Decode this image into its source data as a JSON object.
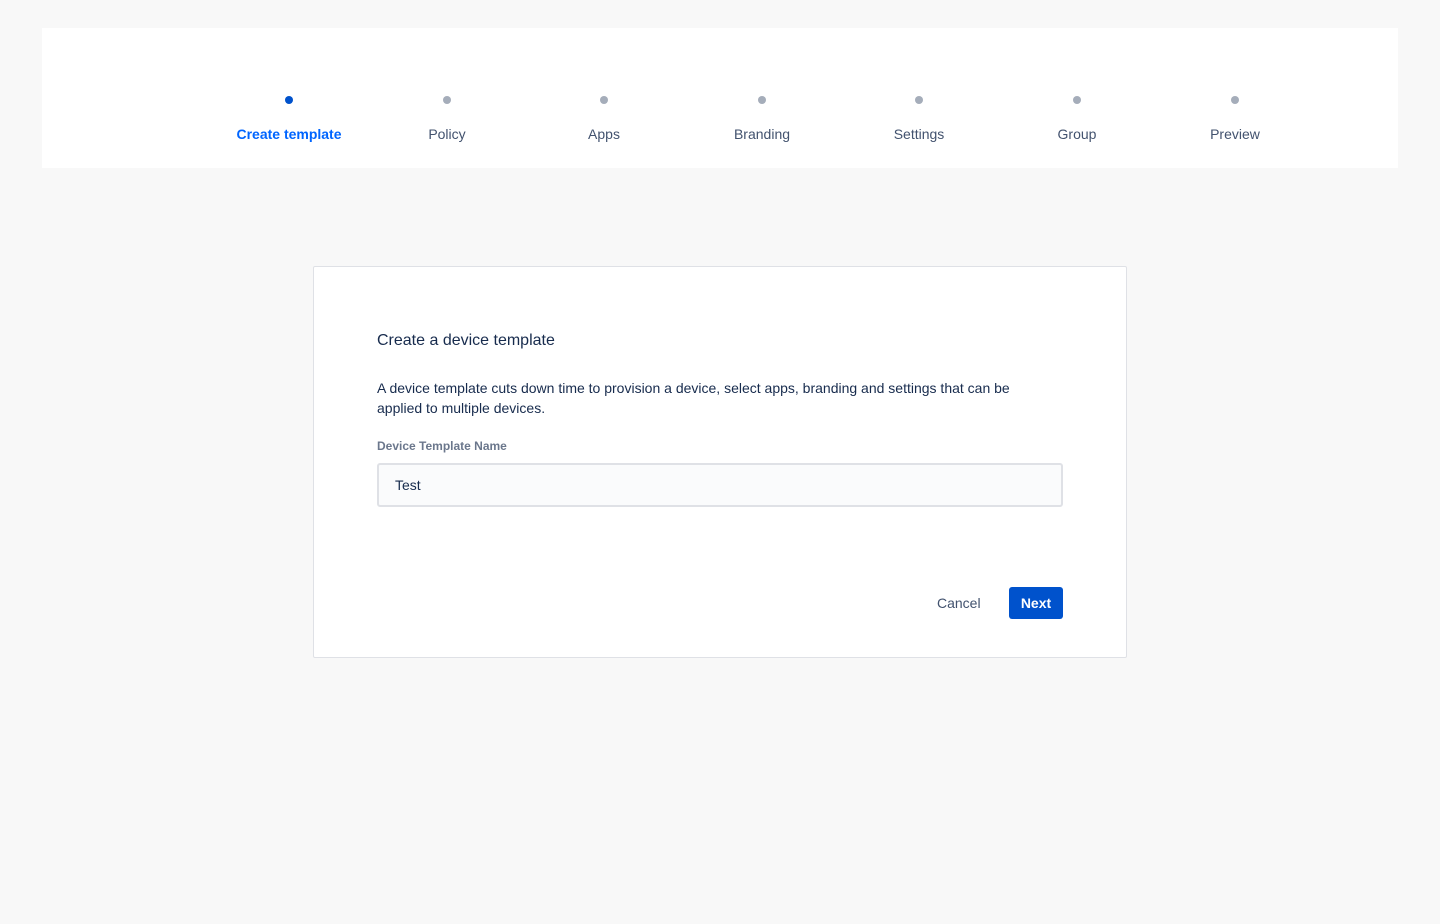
{
  "stepper": {
    "steps": [
      {
        "label": "Create template",
        "active": true
      },
      {
        "label": "Policy",
        "active": false
      },
      {
        "label": "Apps",
        "active": false
      },
      {
        "label": "Branding",
        "active": false
      },
      {
        "label": "Settings",
        "active": false
      },
      {
        "label": "Group",
        "active": false
      },
      {
        "label": "Preview",
        "active": false
      }
    ]
  },
  "card": {
    "title": "Create a device template",
    "description": "A device template cuts down time to provision a device, select apps, branding and settings that can be applied to multiple devices.",
    "field_label": "Device Template Name",
    "field_value": "Test",
    "cancel_label": "Cancel",
    "next_label": "Next"
  },
  "colors": {
    "accent": "#0052cc",
    "active_step_text": "#0065ff",
    "inactive_dot": "#a5adba",
    "background": "#f8f8f8"
  }
}
